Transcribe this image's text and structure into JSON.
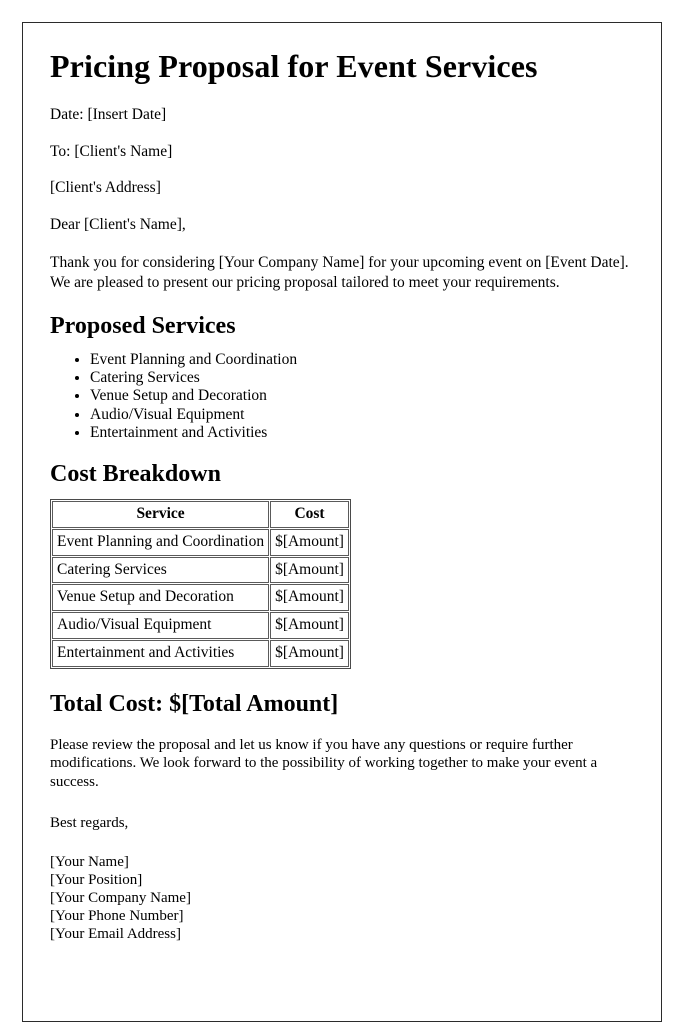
{
  "document": {
    "title": "Pricing Proposal for Event Services",
    "meta": {
      "date_line": "Date: [Insert Date]",
      "to_line": "To: [Client's Name]",
      "address_line": "[Client's Address]",
      "salutation": "Dear [Client's Name],"
    },
    "intro_paragraph": "Thank you for considering [Your Company Name] for your upcoming event on [Event Date]. We are pleased to present our pricing proposal tailored to meet your requirements.",
    "proposed_services": {
      "heading": "Proposed Services",
      "items": [
        "Event Planning and Coordination",
        "Catering Services",
        "Venue Setup and Decoration",
        "Audio/Visual Equipment",
        "Entertainment and Activities"
      ]
    },
    "cost_breakdown": {
      "heading": "Cost Breakdown",
      "columns": [
        "Service",
        "Cost"
      ],
      "rows": [
        {
          "service": "Event Planning and Coordination",
          "cost": "$[Amount]"
        },
        {
          "service": "Catering Services",
          "cost": "$[Amount]"
        },
        {
          "service": "Venue Setup and Decoration",
          "cost": "$[Amount]"
        },
        {
          "service": "Audio/Visual Equipment",
          "cost": "$[Amount]"
        },
        {
          "service": "Entertainment and Activities",
          "cost": "$[Amount]"
        }
      ]
    },
    "total": {
      "heading": "Total Cost: $[Total Amount]"
    },
    "closing_paragraph": "Please review the proposal and let us know if you have any questions or require further modifications. We look forward to the possibility of working together to make your event a success.",
    "signoff": "Best regards,",
    "signature_block": [
      "[Your Name]",
      "[Your Position]",
      "[Your Company Name]",
      "[Your Phone Number]",
      "[Your Email Address]"
    ]
  }
}
